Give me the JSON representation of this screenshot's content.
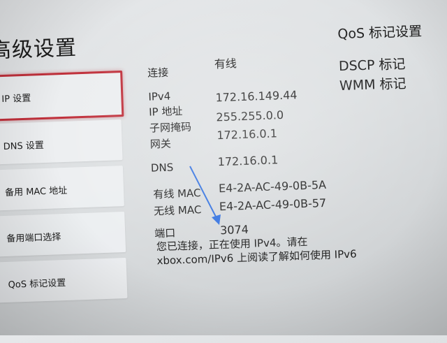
{
  "page": {
    "title": "高级设置"
  },
  "nav": {
    "items": [
      {
        "label": "IP 设置"
      },
      {
        "label": "DNS 设置"
      },
      {
        "label": "备用 MAC 地址"
      },
      {
        "label": "备用端口选择"
      },
      {
        "label": "QoS 标记设置"
      }
    ]
  },
  "info": {
    "connection_label": "连接",
    "connection_value": "有线",
    "ipv4_heading": "IPv4",
    "ip_label": "IP 地址",
    "ip_value": "172.16.149.44",
    "subnet_label": "子网掩码",
    "subnet_value": "255.255.0.0",
    "gateway_label": "网关",
    "gateway_value": "172.16.0.1",
    "dns_label": "DNS",
    "dns_value": "172.16.0.1",
    "wired_mac_label": "有线 MAC",
    "wired_mac_value": "E4-2A-AC-49-0B-5A",
    "wireless_mac_label": "无线 MAC",
    "wireless_mac_value": "E4-2A-AC-49-0B-57",
    "port_label": "端口",
    "port_value": "3074",
    "note": "您已连接，正在使用 IPv4。请在 xbox.com/IPv6 上阅读了解如何使用 IPv6"
  },
  "qos": {
    "title": "QoS 标记设置",
    "items": [
      "DSCP 标记",
      "WMM 标记"
    ]
  },
  "colors": {
    "selection_border": "#c0303b",
    "annotation_arrow": "#2f6fe0"
  }
}
